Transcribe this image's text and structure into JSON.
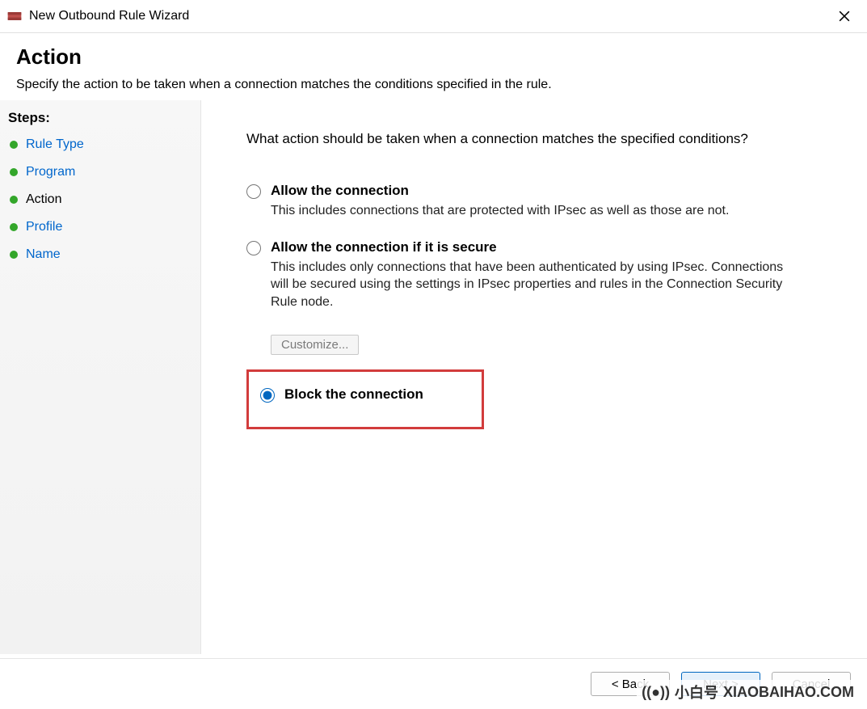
{
  "window": {
    "title": "New Outbound Rule Wizard"
  },
  "header": {
    "title": "Action",
    "subtitle": "Specify the action to be taken when a connection matches the conditions specified in the rule."
  },
  "sidebar": {
    "heading": "Steps:",
    "items": [
      {
        "label": "Rule Type",
        "state": "link"
      },
      {
        "label": "Program",
        "state": "link"
      },
      {
        "label": "Action",
        "state": "current"
      },
      {
        "label": "Profile",
        "state": "link"
      },
      {
        "label": "Name",
        "state": "link"
      }
    ]
  },
  "main": {
    "prompt": "What action should be taken when a connection matches the specified conditions?",
    "options": {
      "allow": {
        "title": "Allow the connection",
        "desc": "This includes connections that are protected with IPsec as well as those are not."
      },
      "allow_secure": {
        "title": "Allow the connection if it is secure",
        "desc": "This includes only connections that have been authenticated by using IPsec.  Connections will be secured using the settings in IPsec properties and rules in the Connection Security Rule node.",
        "customize": "Customize..."
      },
      "block": {
        "title": "Block the connection"
      }
    },
    "selected": "block"
  },
  "footer": {
    "back": "< Back",
    "next": "Next >",
    "cancel": "Cancel"
  },
  "watermark": {
    "label": "小白号",
    "domain": "XIAOBAIHAO.COM"
  }
}
